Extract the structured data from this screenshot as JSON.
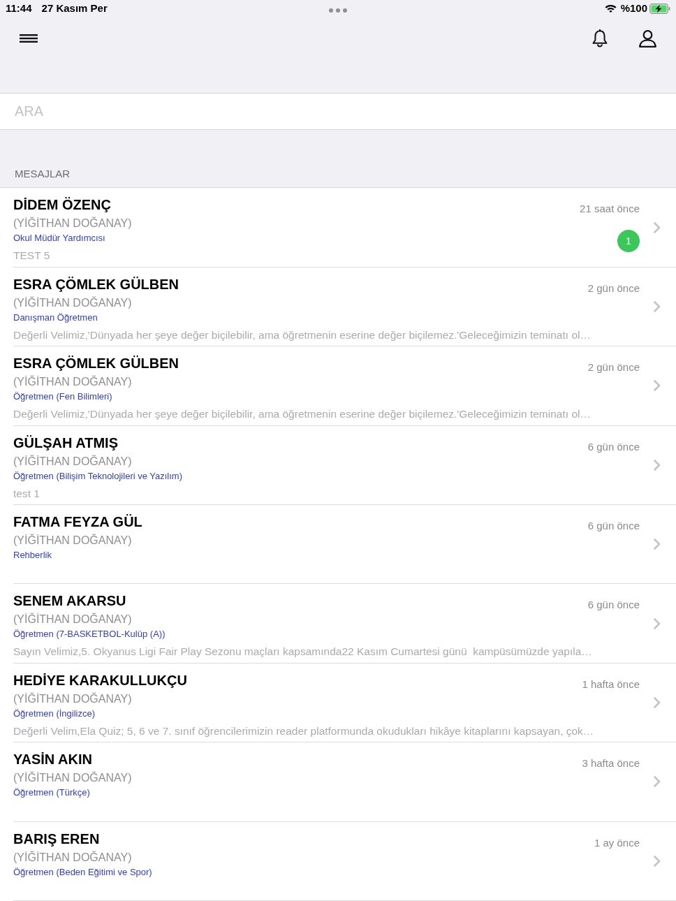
{
  "status_bar": {
    "time": "11:44",
    "date": "27 Kasım Per",
    "battery": "%100"
  },
  "search": {
    "placeholder": "ARA"
  },
  "section": {
    "title": "MESAJLAR"
  },
  "messages": [
    {
      "sender": "DİDEM ÖZENÇ",
      "recipient": "(YİĞİTHAN DOĞANAY)",
      "role": "Okul Müdür Yardımcısı",
      "preview": "TEST 5",
      "time": "21 saat önce",
      "unread": "1"
    },
    {
      "sender": "ESRA ÇÖMLEK GÜLBEN",
      "recipient": "(YİĞİTHAN DOĞANAY)",
      "role": "Danışman Öğretmen",
      "preview": "Değerli Velimiz,'Dünyada her şeye değer biçilebilir, ama öğretmenin eserine değer biçilemez.'Geleceğimizin teminatı ol…",
      "time": "2 gün önce"
    },
    {
      "sender": "ESRA ÇÖMLEK GÜLBEN",
      "recipient": "(YİĞİTHAN DOĞANAY)",
      "role": "Öğretmen (Fen Bilimleri)",
      "preview": "Değerli Velimiz,'Dünyada her şeye değer biçilebilir, ama öğretmenin eserine değer biçilemez.'Geleceğimizin teminatı ol…",
      "time": "2 gün önce"
    },
    {
      "sender": "GÜLŞAH ATMIŞ",
      "recipient": "(YİĞİTHAN DOĞANAY)",
      "role": "Öğretmen (Bilişim Teknolojileri ve Yazılım)",
      "preview": "test 1",
      "time": "6 gün önce"
    },
    {
      "sender": "FATMA FEYZA GÜL",
      "recipient": "(YİĞİTHAN DOĞANAY)",
      "role": "Rehberlik",
      "time": "6 gün önce"
    },
    {
      "sender": "SENEM AKARSU",
      "recipient": "(YİĞİTHAN DOĞANAY)",
      "role": "Öğretmen (7-BASKETBOL-Kulüp (A))",
      "preview": "Sayın Velimiz,5. Okyanus Ligi Fair Play Sezonu maçları kapsamında22 Kasım Cumartesi günü  kampüsümüzde yapıla…",
      "time": "6 gün önce"
    },
    {
      "sender": "HEDİYE KARAKULLUKÇU",
      "recipient": "(YİĞİTHAN DOĞANAY)",
      "role": "Öğretmen (İngilizce)",
      "preview": "Değerli Velim,Ela Quiz; 5, 6 ve 7. sınıf öğrencilerimizin reader platformunda okudukları hikâye kitaplarını kapsayan, çok…",
      "time": "1 hafta önce"
    },
    {
      "sender": "YASİN AKIN",
      "recipient": "(YİĞİTHAN DOĞANAY)",
      "role": "Öğretmen (Türkçe)",
      "time": "3 hafta önce"
    },
    {
      "sender": "BARIŞ EREN",
      "recipient": "(YİĞİTHAN DOĞANAY)",
      "role": "Öğretmen (Beden Eğitimi ve Spor)",
      "time": "1 ay önce"
    }
  ]
}
